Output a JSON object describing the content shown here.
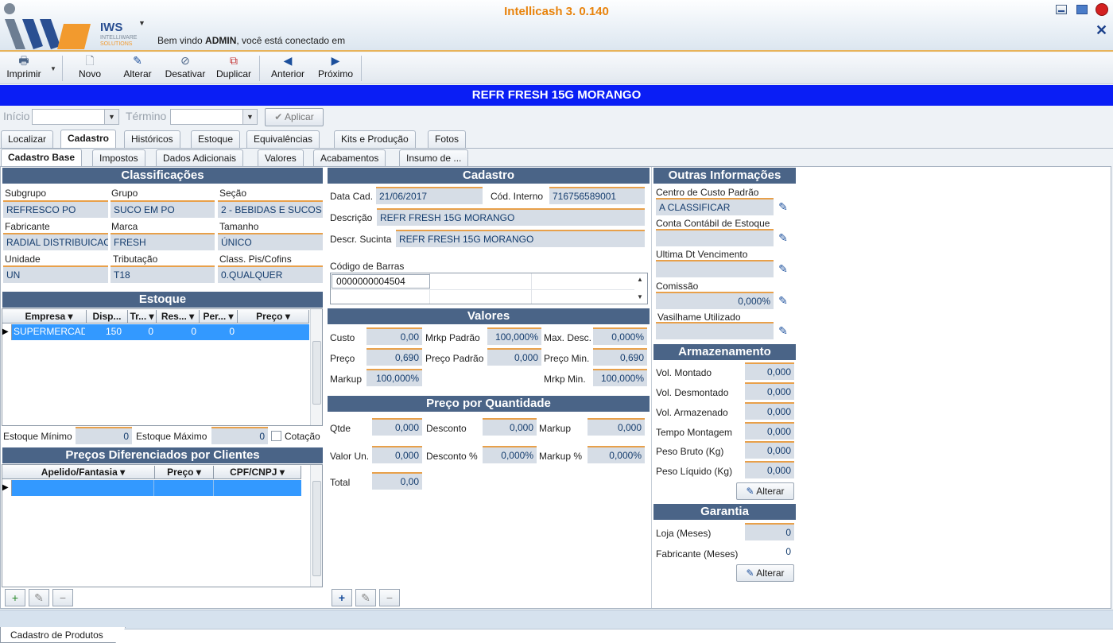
{
  "app": {
    "title": "Intellicash 3. 0.140",
    "logo_name": "IWS",
    "logo_sub1": "INTELLIWARE",
    "logo_sub2": "SOLUTIONS",
    "welcome_prefix": "Bem vindo ",
    "welcome_user": "ADMIN",
    "welcome_suffix": ", você está conectado em"
  },
  "toolbar": {
    "imprimir": "Imprimir",
    "novo": "Novo",
    "alterar": "Alterar",
    "desativar": "Desativar",
    "duplicar": "Duplicar",
    "anterior": "Anterior",
    "proximo": "Próximo"
  },
  "banner": "REFR FRESH 15G MORANGO",
  "filter": {
    "inicio_label": "Início",
    "termino_label": "Término",
    "aplicar": "Aplicar"
  },
  "tabs": [
    "Localizar",
    "Cadastro",
    "Históricos",
    "Estoque",
    "Equivalências",
    "Kits e Produção",
    "Fotos"
  ],
  "subtabs": [
    "Cadastro Base",
    "Impostos",
    "Dados Adicionais",
    "Valores",
    "Acabamentos",
    "Insumo de ..."
  ],
  "classificacoes": {
    "title": "Classificações",
    "subgrupo_label": "Subgrupo",
    "subgrupo": "REFRESCO PO",
    "grupo_label": "Grupo",
    "grupo": "SUCO EM PO",
    "secao_label": "Seção",
    "secao": "2 - BEBIDAS E SUCOS",
    "fabricante_label": "Fabricante",
    "fabricante": "RADIAL DISTRIBUICAO",
    "marca_label": "Marca",
    "marca": "FRESH",
    "tamanho_label": "Tamanho",
    "tamanho": "ÚNICO",
    "unidade_label": "Unidade",
    "unidade": "UN",
    "tributacao_label": "Tributação",
    "tributacao": "T18",
    "pis_label": "Class. Pis/Cofins",
    "pis": "0.QUALQUER"
  },
  "estoque": {
    "title": "Estoque",
    "columns": [
      "Empresa",
      "Disp...",
      "Tr...",
      "Res...",
      "Per...",
      "Preço"
    ],
    "row": {
      "empresa": "SUPERMERCADO",
      "disp": "150",
      "tr": "0",
      "res": "0",
      "per": "0",
      "preco": ""
    },
    "minimo_label": "Estoque Mínimo",
    "minimo": "0",
    "maximo_label": "Estoque Máximo",
    "maximo": "0",
    "cotacao_label": "Cotação"
  },
  "precos_clientes": {
    "title": "Preços Diferenciados por Clientes",
    "columns": [
      "Apelido/Fantasia",
      "Preço",
      "CPF/CNPJ"
    ]
  },
  "cadastro": {
    "title": "Cadastro",
    "data_cad_label": "Data Cad.",
    "data_cad": "21/06/2017",
    "cod_interno_label": "Cód. Interno",
    "cod_interno": "716756589001",
    "descricao_label": "Descrição",
    "descricao": "REFR FRESH 15G MORANGO",
    "sucinta_label": "Descr. Sucinta",
    "sucinta": "REFR FRESH 15G MORANGO",
    "barras_label": "Código de Barras",
    "barras": "0000000004504"
  },
  "valores": {
    "title": "Valores",
    "custo_label": "Custo",
    "custo": "0,00",
    "mrkp_padrao_label": "Mrkp Padrão",
    "mrkp_padrao": "100,000%",
    "max_desc_label": "Max. Desc.",
    "max_desc": "0,000%",
    "preco_label": "Preço",
    "preco": "0,690",
    "preco_padrao_label": "Preço Padrão",
    "preco_padrao": "0,000",
    "preco_min_label": "Preço Min.",
    "preco_min": "0,690",
    "markup_label": "Markup",
    "markup": "100,000%",
    "mrkp_min_label": "Mrkp Min.",
    "mrkp_min": "100,000%"
  },
  "preco_qtd": {
    "title": "Preço por Quantidade",
    "qtde_label": "Qtde",
    "qtde": "0,000",
    "desconto_label": "Desconto",
    "desconto": "0,000",
    "markup_label": "Markup",
    "markup": "0,000",
    "valor_un_label": "Valor Un.",
    "valor_un": "0,000",
    "desconto_pct_label": "Desconto %",
    "desconto_pct": "0,000%",
    "markup_pct_label": "Markup %",
    "markup_pct": "0,000%",
    "total_label": "Total",
    "total": "0,00"
  },
  "outras": {
    "title": "Outras Informações",
    "centro_label": "Centro de Custo Padrão",
    "centro": "A CLASSIFICAR",
    "conta_label": "Conta Contábil de Estoque",
    "conta": "",
    "ultima_label": "Ultima Dt Vencimento",
    "ultima": "",
    "comissao_label": "Comissão",
    "comissao": "0,000%",
    "vasilhame_label": "Vasilhame Utilizado",
    "vasilhame": ""
  },
  "armazenamento": {
    "title": "Armazenamento",
    "vol_montado_label": "Vol. Montado",
    "vol_montado": "0,000",
    "vol_desmontado_label": "Vol. Desmontado",
    "vol_desmontado": "0,000",
    "vol_armazenado_label": "Vol. Armazenado",
    "vol_armazenado": "0,000",
    "tempo_label": "Tempo Montagem",
    "tempo": "0,000",
    "peso_bruto_label": "Peso Bruto (Kg)",
    "peso_bruto": "0,000",
    "peso_liquido_label": "Peso Líquido (Kg)",
    "peso_liquido": "0,000",
    "alterar": "Alterar"
  },
  "garantia": {
    "title": "Garantia",
    "loja_label": "Loja (Meses)",
    "loja": "0",
    "fabricante_label": "Fabricante (Meses)",
    "fabricante": "0",
    "alterar": "Alterar"
  },
  "bottom_tab": "Cadastro de Produtos",
  "colors": {
    "accent": "#e8830c",
    "banner": "#0a1ef5",
    "header": "#4a6487",
    "selection": "#3399ff",
    "field": "#d6dde6"
  }
}
